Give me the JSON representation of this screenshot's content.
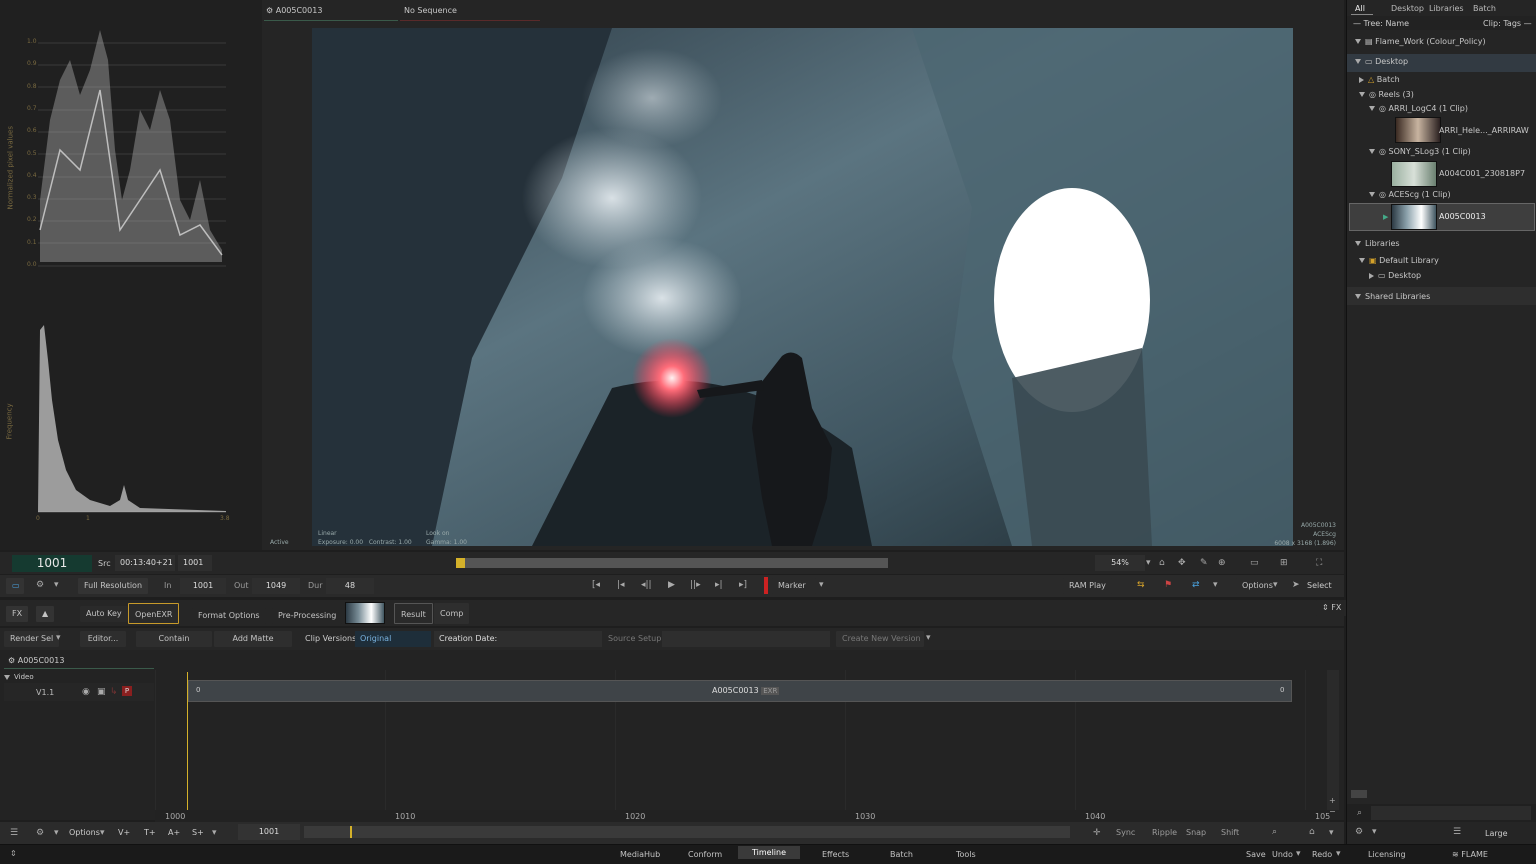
{
  "viewer": {
    "clip_tab": "A005C0013",
    "sequence_tab": "No Sequence",
    "status": "Active",
    "look_label": "Linear",
    "exposure": "Exposure: 0.00",
    "contrast": "Contrast: 1.00",
    "look_on": "Look on",
    "gamma": "Gamma: 1.00",
    "meta_clip": "A005C0013",
    "meta_colorspace": "ACEScg",
    "meta_res": "6008 x 3168 (1.896)"
  },
  "scopes": {
    "waveform_ylabel": "Normalized pixel values",
    "waveform_ticks": [
      "1.0",
      "0.9",
      "0.8",
      "0.7",
      "0.6",
      "0.5",
      "0.4",
      "0.3",
      "0.2",
      "0.1",
      "0.0"
    ],
    "histogram_ylabel": "Frequency",
    "histogram_ticks": [
      "0",
      "1",
      "3.8"
    ]
  },
  "transport": {
    "frame": "1001",
    "src_label": "Src",
    "timecode": "00:13:40+21",
    "src_frame": "1001",
    "zoom": "54%",
    "resolution": "Full Resolution",
    "in_label": "In",
    "in_value": "1001",
    "out_label": "Out",
    "out_value": "1049",
    "dur_label": "Dur",
    "dur_value": "48",
    "marker": "Marker",
    "ram_play": "RAM Play",
    "options": "Options",
    "select": "Select"
  },
  "fxbar": {
    "fx": "FX",
    "auto_key": "Auto Key",
    "openexr": "OpenEXR",
    "format_options": "Format Options",
    "pre_processing": "Pre-Processing",
    "result": "Result",
    "comp": "Comp",
    "fx_right": "FX"
  },
  "clipbar": {
    "render_sel": "Render Sel",
    "editor": "Editor...",
    "contain": "Contain",
    "add_matte": "Add Matte",
    "clip_versions": "Clip Versions",
    "original": "Original",
    "creation_date": "Creation Date:",
    "source_setup": "Source Setup",
    "create_new_version": "Create New Version"
  },
  "timeline": {
    "clip_name": "A005C0013",
    "video_label": "Video",
    "track": "V1.1",
    "segment_name": "A005C0013",
    "segment_tag": "EXR",
    "seg_start": "0",
    "seg_end": "0",
    "ruler": [
      "1000",
      "1010",
      "1020",
      "1030",
      "1040",
      "105"
    ],
    "current": "1001",
    "progress": 0.06
  },
  "bottombar": {
    "options": "Options",
    "v": "V+",
    "t": "T+",
    "a": "A+",
    "s": "S+",
    "sync": "Sync",
    "ripple": "Ripple",
    "snap": "Snap",
    "shift": "Shift"
  },
  "library": {
    "tabs": [
      "All",
      "Desktop",
      "Libraries",
      "Batch"
    ],
    "tree_name": "— Tree: Name",
    "clip_tags": "Clip: Tags —",
    "project": "Flame_Work (Colour_Policy)",
    "desktop": "Desktop",
    "batch": "Batch",
    "reels": "Reels (3)",
    "reel1": "ARRI_LogC4 (1 Clip)",
    "reel1_clip": "ARRI_Hele..._ARRIRAW",
    "reel2": "SONY_SLog3 (1 Clip)",
    "reel2_clip": "A004C001_230818P7",
    "reel3": "ACEScg (1 Clip)",
    "reel3_clip": "A005C0013",
    "libraries": "Libraries",
    "default_library": "Default Library",
    "lib_desktop": "Desktop",
    "shared_libraries": "Shared Libraries",
    "size": "Large"
  },
  "footer": {
    "tabs": [
      "MediaHub",
      "Conform",
      "Timeline",
      "Effects",
      "Batch",
      "Tools"
    ],
    "active_tab": "Timeline",
    "save": "Save",
    "undo": "Undo",
    "redo": "Redo",
    "licensing": "Licensing",
    "brand": "FLAME"
  },
  "colors": {
    "accent_yellow": "#d4b12a",
    "record_red": "#c22",
    "frame_green": "#153a30"
  }
}
